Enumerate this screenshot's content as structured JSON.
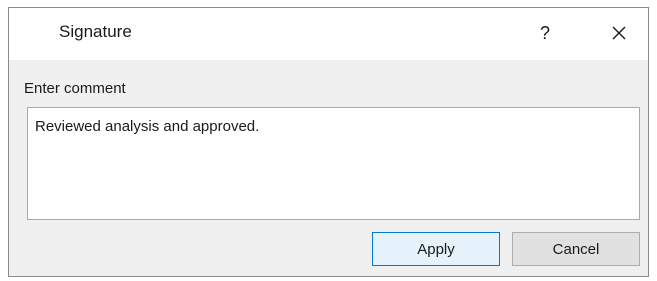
{
  "dialog": {
    "title": "Signature",
    "help_label": "?",
    "close_icon": "close-icon"
  },
  "form": {
    "comment_label": "Enter comment",
    "comment_value": "Reviewed analysis and approved."
  },
  "buttons": {
    "apply_label": "Apply",
    "cancel_label": "Cancel"
  },
  "colors": {
    "dialog_background": "#f0f0f0",
    "titlebar_background": "#ffffff",
    "default_button_border": "#0078d7",
    "default_button_fill": "#e5f1fb"
  }
}
